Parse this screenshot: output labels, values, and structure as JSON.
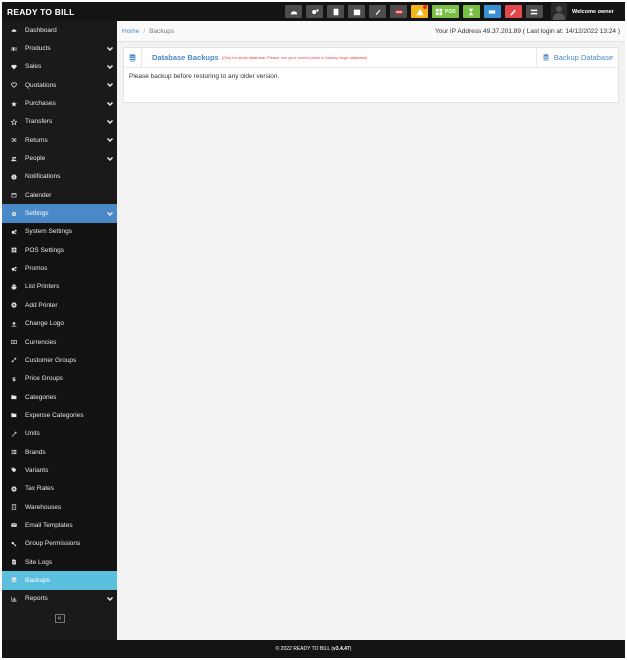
{
  "brand": "READY TO BILL",
  "topbar": {
    "pos_label": "POS",
    "welcome": "Welcome owner"
  },
  "sidebar": {
    "items": [
      {
        "label": "Dashboard",
        "icon": "dashboard-icon",
        "chevron": false,
        "state": ""
      },
      {
        "label": "Products",
        "icon": "barcode-icon",
        "chevron": true,
        "state": ""
      },
      {
        "label": "Sales",
        "icon": "heart-icon",
        "chevron": true,
        "state": ""
      },
      {
        "label": "Quotations",
        "icon": "heart-outline-icon",
        "chevron": true,
        "state": ""
      },
      {
        "label": "Purchases",
        "icon": "star-icon",
        "chevron": true,
        "state": ""
      },
      {
        "label": "Transfers",
        "icon": "star-outline-icon",
        "chevron": true,
        "state": ""
      },
      {
        "label": "Returns",
        "icon": "random-icon",
        "chevron": true,
        "state": ""
      },
      {
        "label": "People",
        "icon": "users-icon",
        "chevron": true,
        "state": ""
      },
      {
        "label": "Notifications",
        "icon": "info-icon",
        "chevron": false,
        "state": ""
      },
      {
        "label": "Calender",
        "icon": "calendar-icon",
        "chevron": false,
        "state": ""
      },
      {
        "label": "Settings",
        "icon": "cog-icon",
        "chevron": true,
        "state": "active-parent"
      },
      {
        "label": "System Settings",
        "icon": "cogs-icon",
        "chevron": false,
        "state": "sub"
      },
      {
        "label": "POS Settings",
        "icon": "th-large-icon",
        "chevron": false,
        "state": "sub"
      },
      {
        "label": "Promos",
        "icon": "cogs-icon",
        "chevron": false,
        "state": "sub"
      },
      {
        "label": "List Printers",
        "icon": "print-icon",
        "chevron": false,
        "state": "sub"
      },
      {
        "label": "Add Printer",
        "icon": "plus-circle-icon",
        "chevron": false,
        "state": "sub"
      },
      {
        "label": "Change Logo",
        "icon": "upload-icon",
        "chevron": false,
        "state": "sub"
      },
      {
        "label": "Currencies",
        "icon": "money-icon",
        "chevron": false,
        "state": "sub"
      },
      {
        "label": "Customer Groups",
        "icon": "chain-icon",
        "chevron": false,
        "state": "sub"
      },
      {
        "label": "Price Groups",
        "icon": "dollar-icon",
        "chevron": false,
        "state": "sub"
      },
      {
        "label": "Categories",
        "icon": "folder-open-icon",
        "chevron": false,
        "state": "sub"
      },
      {
        "label": "Expense Categories",
        "icon": "folder-open-icon",
        "chevron": false,
        "state": "sub"
      },
      {
        "label": "Units",
        "icon": "wrench-icon",
        "chevron": false,
        "state": "sub"
      },
      {
        "label": "Brands",
        "icon": "th-list-icon",
        "chevron": false,
        "state": "sub"
      },
      {
        "label": "Variants",
        "icon": "tags-icon",
        "chevron": false,
        "state": "sub"
      },
      {
        "label": "Tax Rates",
        "icon": "plus-circle-icon",
        "chevron": false,
        "state": "sub"
      },
      {
        "label": "Warehouses",
        "icon": "building-icon",
        "chevron": false,
        "state": "sub"
      },
      {
        "label": "Email Templates",
        "icon": "envelope-icon",
        "chevron": false,
        "state": "sub"
      },
      {
        "label": "Group Permissions",
        "icon": "key-icon",
        "chevron": false,
        "state": "sub"
      },
      {
        "label": "Site Logs",
        "icon": "file-text-icon",
        "chevron": false,
        "state": "sub"
      },
      {
        "label": "Backups",
        "icon": "database-icon",
        "chevron": false,
        "state": "active-child"
      },
      {
        "label": "Reports",
        "icon": "bar-chart-icon",
        "chevron": true,
        "state": ""
      }
    ],
    "collapse_glyph": "«"
  },
  "breadcrumb": {
    "home": "Home",
    "separator": "/",
    "current": "Backups"
  },
  "ip_info": "Your IP Address 49.37.201.89 ( Last login at: 14/12/2022 13:24 )",
  "panel": {
    "title": "Database Backups",
    "note": "(Only for small database, Please use your control panel to backup large database)",
    "action": "Backup Database",
    "body_text": "Please backup before restoring to any older version."
  },
  "footer": {
    "prefix": "© 2022 READY TO BILL (",
    "version": "v3.4.47",
    "suffix": ")"
  },
  "colors": {
    "accent": "#4a89c8",
    "active_child": "#5bc0de",
    "sidebar_bg": "#1a1a1a",
    "content_bg": "#f2f2f2",
    "note_red": "#e2474b"
  }
}
